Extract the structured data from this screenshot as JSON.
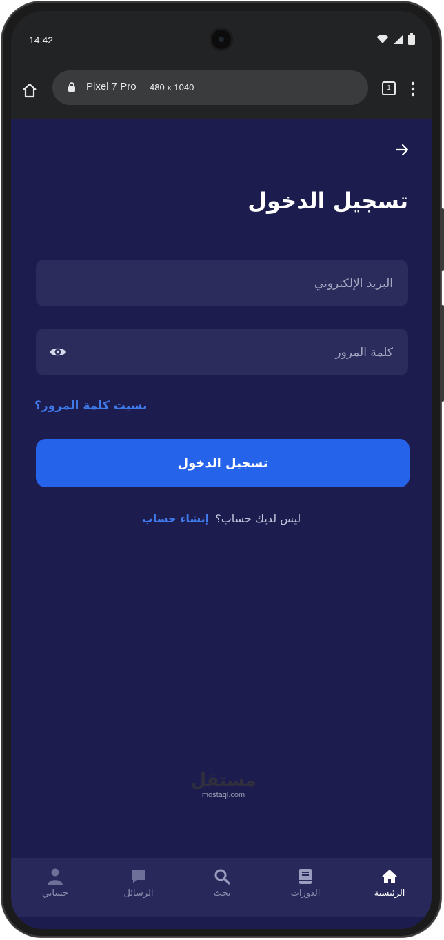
{
  "status_bar": {
    "time": "14:42"
  },
  "browser": {
    "device": "Pixel 7 Pro",
    "size": "480 x 1040",
    "tab_count": "1"
  },
  "page": {
    "title": "تسجيل الدخول",
    "email_placeholder": "البريد الإلكتروني",
    "password_placeholder": "كلمة المرور",
    "forgot_password": "نسيت كلمة المرور؟",
    "login_button": "تسجيل الدخول",
    "no_account": "ليس لديك حساب؟",
    "create_account": "إنشاء حساب"
  },
  "bottom_nav": {
    "items": [
      {
        "label": "الرئيسية",
        "icon": "home-icon"
      },
      {
        "label": "الدورات",
        "icon": "book-icon"
      },
      {
        "label": "بحث",
        "icon": "search-icon"
      },
      {
        "label": "الرسائل",
        "icon": "chat-icon"
      },
      {
        "label": "حسابي",
        "icon": "user-icon"
      }
    ]
  },
  "watermark": {
    "arabic": "مستقل",
    "latin": "mostaql.com"
  },
  "colors": {
    "background": "#1c1c4e",
    "field": "#2b2c5c",
    "accent": "#2563eb",
    "link": "#3f79ea",
    "nav": "#28295a"
  }
}
